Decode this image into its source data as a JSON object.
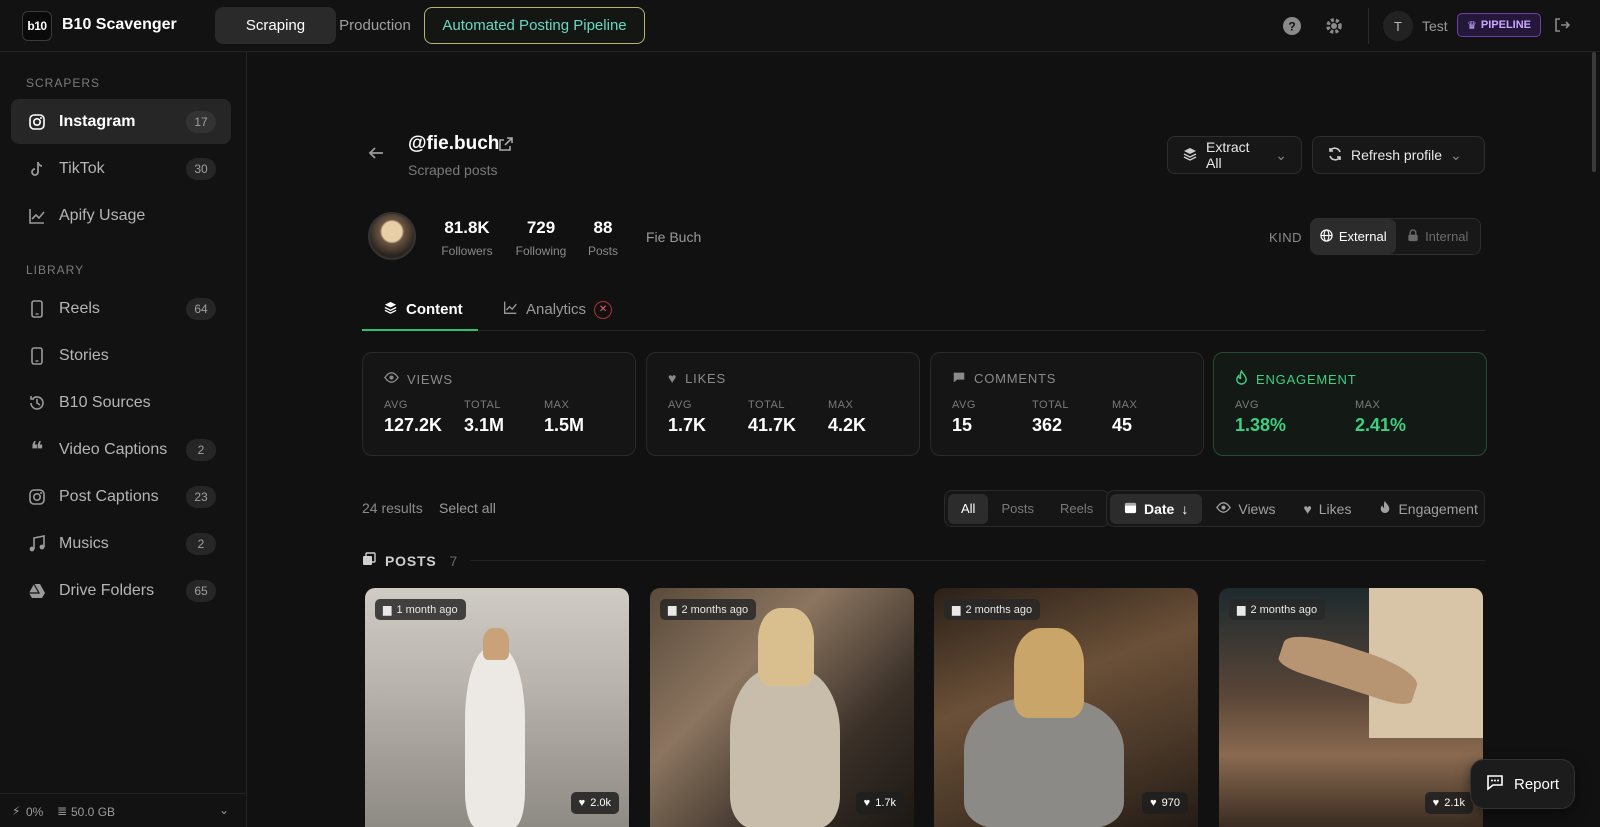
{
  "app": {
    "logo": "b10",
    "name": "B10 Scavenger"
  },
  "nav": {
    "scraping": "Scraping",
    "production": "Production",
    "pipeline": "Automated Posting Pipeline"
  },
  "user": {
    "initial": "T",
    "name": "Test",
    "badge": "PIPELINE"
  },
  "sidebar": {
    "scrapers_title": "SCRAPERS",
    "library_title": "LIBRARY",
    "scrapers": [
      {
        "label": "Instagram",
        "count": "17",
        "icon": "instagram-icon"
      },
      {
        "label": "TikTok",
        "count": "30",
        "icon": "tiktok-icon"
      },
      {
        "label": "Apify Usage",
        "count": "",
        "icon": "chart-line-icon"
      }
    ],
    "library": [
      {
        "label": "Reels",
        "count": "64",
        "icon": "phone-icon"
      },
      {
        "label": "Stories",
        "count": "",
        "icon": "phone-icon"
      },
      {
        "label": "B10 Sources",
        "count": "",
        "icon": "history-icon"
      },
      {
        "label": "Video Captions",
        "count": "2",
        "icon": "quote-icon"
      },
      {
        "label": "Post Captions",
        "count": "23",
        "icon": "instagram-icon"
      },
      {
        "label": "Musics",
        "count": "2",
        "icon": "music-icon"
      },
      {
        "label": "Drive Folders",
        "count": "65",
        "icon": "drive-icon"
      }
    ],
    "footer": {
      "percent": "0%",
      "storage": "50.0 GB"
    }
  },
  "profile": {
    "handle": "@fie.buch",
    "subtitle": "Scraped posts",
    "extract_all": "Extract All",
    "refresh": "Refresh profile",
    "followers": "81.8K",
    "followers_label": "Followers",
    "following": "729",
    "following_label": "Following",
    "posts": "88",
    "posts_label": "Posts",
    "full_name": "Fie Buch",
    "kind_label": "KIND",
    "kind_external": "External",
    "kind_internal": "Internal"
  },
  "tabs": {
    "content": "Content",
    "analytics": "Analytics"
  },
  "metrics": {
    "views": {
      "title": "VIEWS",
      "avg_label": "AVG",
      "avg": "127.2K",
      "total_label": "TOTAL",
      "total": "3.1M",
      "max_label": "MAX",
      "max": "1.5M"
    },
    "likes": {
      "title": "LIKES",
      "avg_label": "AVG",
      "avg": "1.7K",
      "total_label": "TOTAL",
      "total": "41.7K",
      "max_label": "MAX",
      "max": "4.2K"
    },
    "comments": {
      "title": "COMMENTS",
      "avg_label": "AVG",
      "avg": "15",
      "total_label": "TOTAL",
      "total": "362",
      "max_label": "MAX",
      "max": "45"
    },
    "engagement": {
      "title": "ENGAGEMENT",
      "avg_label": "AVG",
      "avg": "1.38%",
      "max_label": "MAX",
      "max": "2.41%"
    }
  },
  "results": {
    "count": "24 results",
    "select_all": "Select all"
  },
  "filters": {
    "all": "All",
    "posts": "Posts",
    "reels": "Reels"
  },
  "sort": {
    "date": "Date",
    "views": "Views",
    "likes": "Likes",
    "engagement": "Engagement"
  },
  "posts_section": {
    "title": "POSTS",
    "count": "7"
  },
  "posts": [
    {
      "date": "1 month ago",
      "likes": "2.0k"
    },
    {
      "date": "2 months ago",
      "likes": "1.7k"
    },
    {
      "date": "2 months ago",
      "likes": "970"
    },
    {
      "date": "2 months ago",
      "likes": "2.1k"
    }
  ],
  "report": "Report",
  "colors": {
    "accent_green": "#2fbf71",
    "pipeline_border": "#b8b26a",
    "badge_purple": "#c9a6ff"
  }
}
